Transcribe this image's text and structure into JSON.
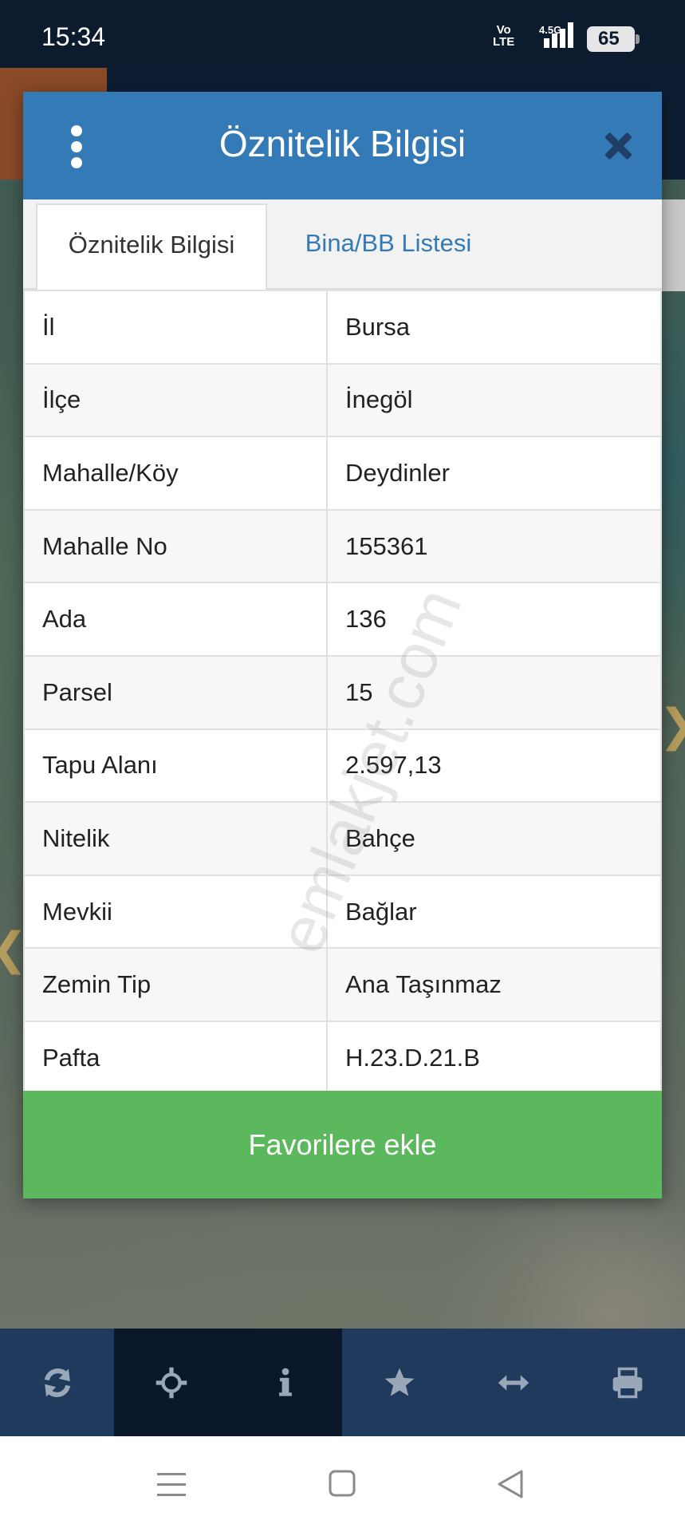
{
  "status_bar": {
    "time": "15:34",
    "volte_top": "Vo",
    "volte_bottom": "LTE",
    "network": "4.5G",
    "battery": "65"
  },
  "dialog": {
    "title": "Öznitelik Bilgisi",
    "tabs": [
      {
        "label": "Öznitelik Bilgisi",
        "active": true
      },
      {
        "label": "Bina/BB Listesi",
        "active": false
      }
    ],
    "rows": [
      {
        "key": "İl",
        "value": "Bursa"
      },
      {
        "key": "İlçe",
        "value": "İnegöl"
      },
      {
        "key": "Mahalle/Köy",
        "value": "Deydinler"
      },
      {
        "key": "Mahalle No",
        "value": "155361"
      },
      {
        "key": "Ada",
        "value": "136"
      },
      {
        "key": "Parsel",
        "value": "15"
      },
      {
        "key": "Tapu Alanı",
        "value": "2.597,13"
      },
      {
        "key": "Nitelik",
        "value": "Bahçe"
      },
      {
        "key": "Mevkii",
        "value": "Bağlar"
      },
      {
        "key": "Zemin Tip",
        "value": "Ana Taşınmaz"
      },
      {
        "key": "Pafta",
        "value": "H.23.D.21.B"
      }
    ],
    "favorite_button": "Favorilere ekle"
  },
  "watermark": "emlakjet.com",
  "toolbar": {
    "icons": [
      "refresh-icon",
      "crosshair-icon",
      "info-icon",
      "star-icon",
      "arrows-horizontal-icon",
      "print-icon"
    ]
  },
  "navbar": {
    "icons": [
      "menu-icon",
      "home-icon",
      "back-icon"
    ]
  },
  "colors": {
    "header": "#337ab7",
    "favorite": "#5cb85c",
    "toolbar": "#1f3a5c",
    "status_bar": "#0c1b2e"
  }
}
